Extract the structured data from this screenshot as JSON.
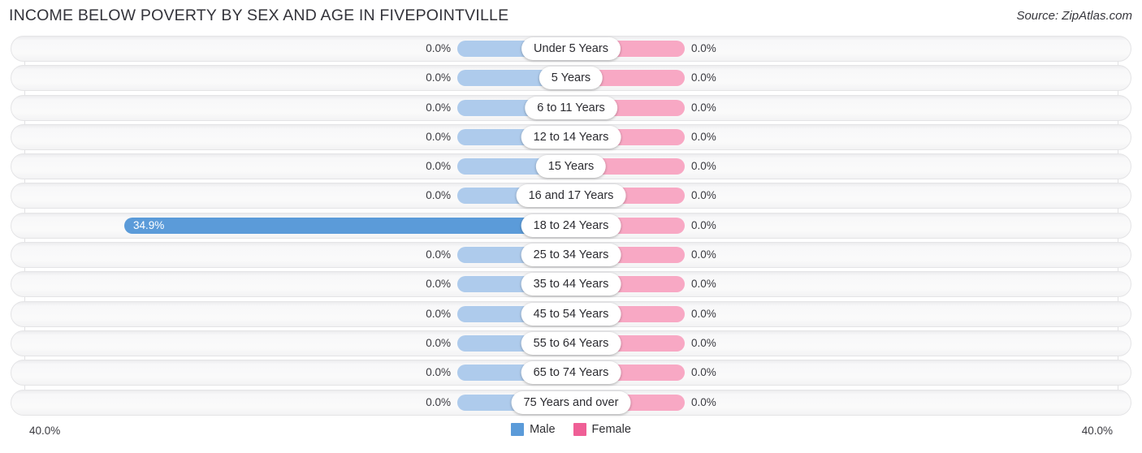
{
  "header": {
    "title": "INCOME BELOW POVERTY BY SEX AND AGE IN FIVEPOINTVILLE",
    "source": "Source: ZipAtlas.com"
  },
  "axis": {
    "left_label": "40.0%",
    "right_label": "40.0%"
  },
  "legend": {
    "items": [
      {
        "label": "Male",
        "color": "#5b9bd9"
      },
      {
        "label": "Female",
        "color": "#ef5f96"
      }
    ]
  },
  "colors": {
    "male_base": "#aecbec",
    "male_highlight": "#5b9bd9",
    "female_base": "#f8a8c4",
    "female_highlight": "#ef5f96",
    "track": "#fafafa"
  },
  "chart_data": {
    "type": "bar",
    "title": "INCOME BELOW POVERTY BY SEX AND AGE IN FIVEPOINTVILLE",
    "subtitle": "",
    "xlabel": "",
    "ylabel": "",
    "orientation": "horizontal",
    "layout": "diverging-bidirectional",
    "grid": true,
    "legend_position": "bottom-center",
    "axis_max_percent": 40.0,
    "axis_tick_labels": [
      "40.0%",
      "40.0%"
    ],
    "categories": [
      "Under 5 Years",
      "5 Years",
      "6 to 11 Years",
      "12 to 14 Years",
      "15 Years",
      "16 and 17 Years",
      "18 to 24 Years",
      "25 to 34 Years",
      "35 to 44 Years",
      "45 to 54 Years",
      "55 to 64 Years",
      "65 to 74 Years",
      "75 Years and over"
    ],
    "series": [
      {
        "name": "Male",
        "side": "left",
        "values": [
          0.0,
          0.0,
          0.0,
          0.0,
          0.0,
          0.0,
          34.9,
          0.0,
          0.0,
          0.0,
          0.0,
          0.0,
          0.0
        ],
        "labels": [
          "0.0%",
          "0.0%",
          "0.0%",
          "0.0%",
          "0.0%",
          "0.0%",
          "34.9%",
          "0.0%",
          "0.0%",
          "0.0%",
          "0.0%",
          "0.0%",
          "0.0%"
        ]
      },
      {
        "name": "Female",
        "side": "right",
        "values": [
          0.0,
          0.0,
          0.0,
          0.0,
          0.0,
          0.0,
          0.0,
          0.0,
          0.0,
          0.0,
          0.0,
          0.0,
          0.0
        ],
        "labels": [
          "0.0%",
          "0.0%",
          "0.0%",
          "0.0%",
          "0.0%",
          "0.0%",
          "0.0%",
          "0.0%",
          "0.0%",
          "0.0%",
          "0.0%",
          "0.0%",
          "0.0%"
        ]
      }
    ]
  }
}
